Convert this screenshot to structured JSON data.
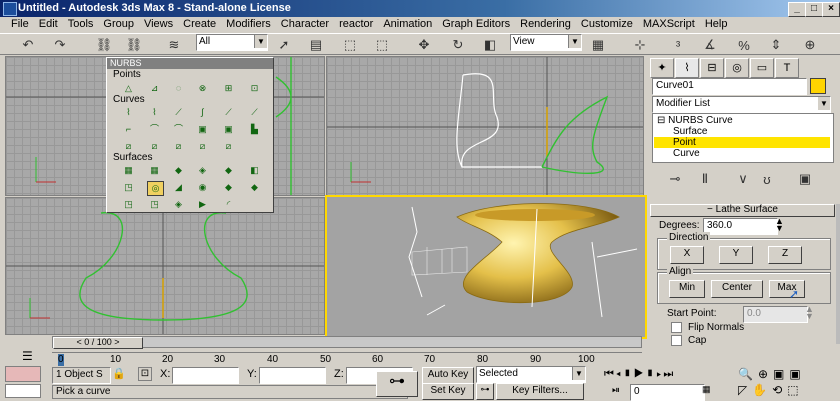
{
  "window": {
    "title": "Untitled - Autodesk 3ds Max 8 - Stand-alone License"
  },
  "menu": [
    "File",
    "Edit",
    "Tools",
    "Group",
    "Views",
    "Create",
    "Modifiers",
    "Character",
    "reactor",
    "Animation",
    "Graph Editors",
    "Rendering",
    "Customize",
    "MAXScript",
    "Help"
  ],
  "toolbar": {
    "filter_value": "All",
    "coord_value": "View"
  },
  "nurbs_palette": {
    "title": "NURBS",
    "points_label": "Points",
    "curves_label": "Curves",
    "surfaces_label": "Surfaces"
  },
  "command_panel": {
    "object_name": "Curve01",
    "modifier_list": "Modifier List",
    "stack": [
      "NURBS Curve",
      "Surface",
      "Point",
      "Curve"
    ],
    "selected_stack_index": 2,
    "rollout_title": "Lathe Surface",
    "degrees_label": "Degrees:",
    "degrees_value": "360.0",
    "direction_label": "Direction",
    "dir_buttons": [
      "X",
      "Y",
      "Z"
    ],
    "align_label": "Align",
    "align_buttons": [
      "Min",
      "Center",
      "Max"
    ],
    "start_point_label": "Start Point:",
    "start_point_value": "0.0",
    "flip_normals": "Flip Normals",
    "cap": "Cap"
  },
  "timeline": {
    "slider_text": "0 / 100",
    "ticks": [
      "0",
      "10",
      "20",
      "30",
      "40",
      "50",
      "60",
      "70",
      "80",
      "90",
      "100"
    ]
  },
  "status": {
    "selection": "1 Object S",
    "x_label": "X:",
    "y_label": "Y:",
    "z_label": "Z:",
    "prompt": "Pick a curve",
    "auto_key": "Auto Key",
    "set_key": "Set Key",
    "key_mode": "Selected",
    "key_filters": "Key Filters...",
    "frame": "0"
  },
  "colors": {
    "active_viewport": "#ffd800",
    "curve": "#31c131",
    "selection_highlight": "#ffe400"
  }
}
